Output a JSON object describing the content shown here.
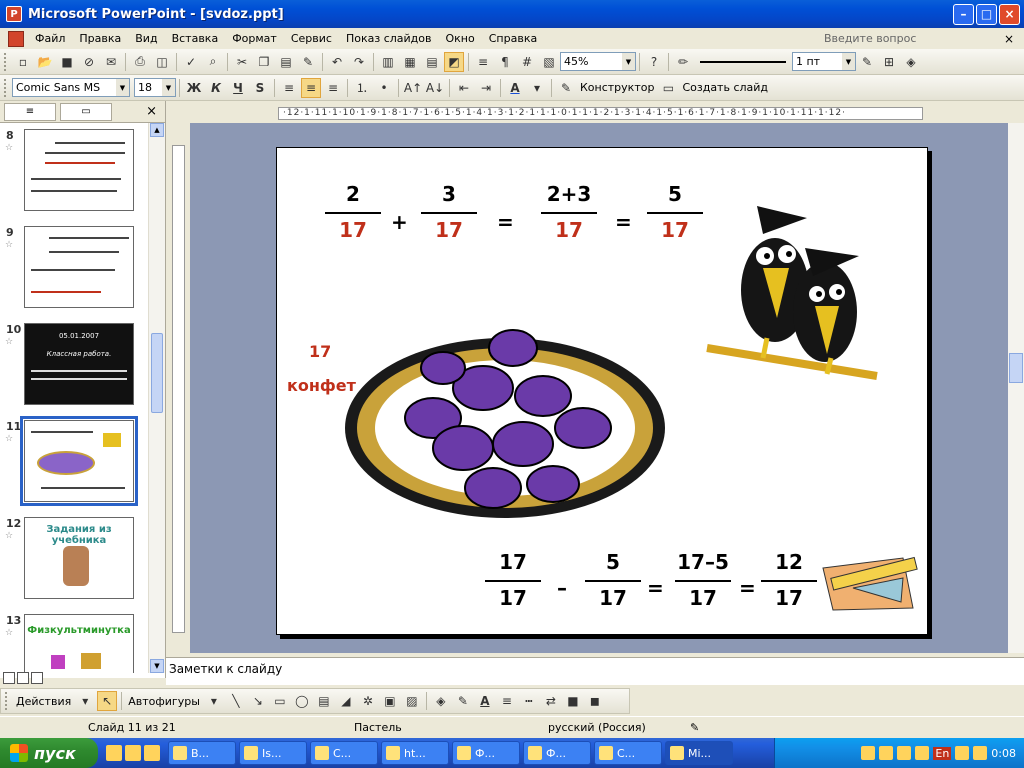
{
  "window": {
    "title": "Microsoft PowerPoint - [svdoz.ppt]",
    "app_icon": "powerpoint-icon"
  },
  "menu": {
    "items": [
      "Файл",
      "Правка",
      "Вид",
      "Вставка",
      "Формат",
      "Сервис",
      "Показ слайдов",
      "Окно",
      "Справка"
    ],
    "help_placeholder": "Введите вопрос"
  },
  "toolbar_standard": {
    "zoom": "45%",
    "line_width": "1 пт"
  },
  "toolbar_format": {
    "font": "Comic Sans MS",
    "font_size": "18",
    "bold": "Ж",
    "italic": "К",
    "underline": "Ч",
    "shadow": "S",
    "designer": "Конструктор",
    "new_slide": "Создать слайд"
  },
  "slides_panel": {
    "thumbs": [
      {
        "num": "8",
        "label": ""
      },
      {
        "num": "9",
        "label": ""
      },
      {
        "num": "10",
        "label": "Классная работа."
      },
      {
        "num": "11",
        "label": ""
      },
      {
        "num": "12",
        "label": "Задания из учебника"
      },
      {
        "num": "13",
        "label": "Физкультминутка"
      }
    ],
    "date_on_10": "05.01.2007"
  },
  "ruler": {
    "h_ticks": "·12·1·11·1·10·1·9·1·8·1·7·1·6·1·5·1·4·1·3·1·2·1·1·1·0·1·1·1·2·1·3·1·4·1·5·1·6·1·7·1·8·1·9·1·10·1·11·1·12·"
  },
  "slide": {
    "top_eq": {
      "f1_num": "2",
      "f1_den": "17",
      "op1": "+",
      "f2_num": "3",
      "f2_den": "17",
      "op2": "=",
      "f3_num": "2+3",
      "f3_den": "17",
      "op3": "=",
      "f4_num": "5",
      "f4_den": "17"
    },
    "candy_count": "17",
    "candy_label": "конфет",
    "bottom_eq": {
      "f1_num": "17",
      "f1_den": "17",
      "op1": "–",
      "f2_num": "5",
      "f2_den": "17",
      "op2": "=",
      "f3_num": "17–5",
      "f3_den": "17",
      "op3": "=",
      "f4_num": "12",
      "f4_den": "17"
    }
  },
  "notes_placeholder": "Заметки к слайду",
  "draw_toolbar": {
    "actions": "Действия",
    "autoshapes": "Автофигуры"
  },
  "status": {
    "slide_pos": "Слайд 11 из 21",
    "design": "Пастель",
    "language": "русский (Россия)"
  },
  "taskbar": {
    "start": "пуск",
    "items": [
      "В...",
      "Is...",
      "С...",
      "ht...",
      "Ф...",
      "Ф...",
      "С...",
      "Mi..."
    ],
    "clock": "0:08",
    "lang": "En"
  },
  "colors": {
    "accent_red": "#c0301a",
    "title_blue": "#0446c8",
    "candy_purple": "#6a3aa8"
  }
}
